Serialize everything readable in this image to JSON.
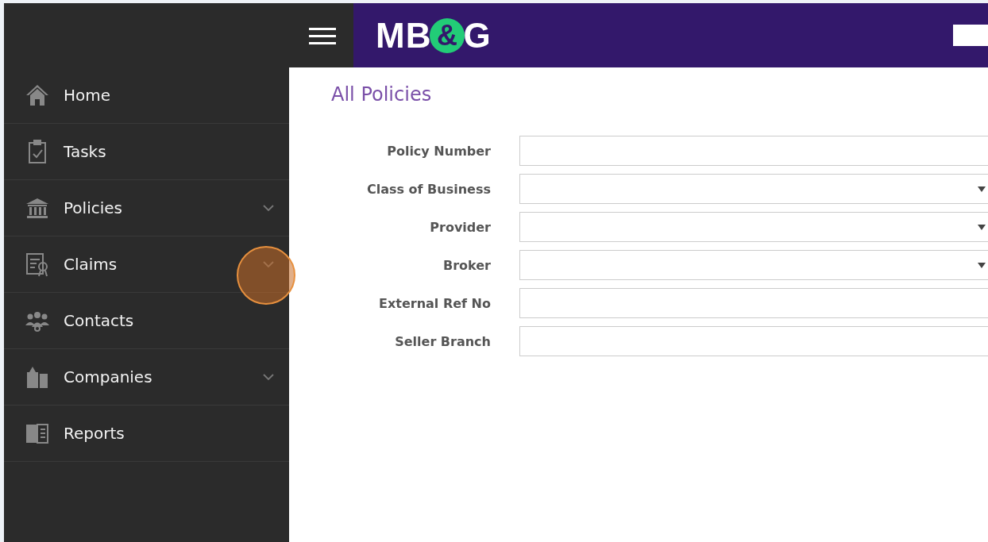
{
  "header": {
    "logo": {
      "text_before": "MB",
      "mark": "&",
      "text_after": "G"
    }
  },
  "sidebar": {
    "items": [
      {
        "label": "Home",
        "expandable": false,
        "highlighted": false
      },
      {
        "label": "Tasks",
        "expandable": false,
        "highlighted": false
      },
      {
        "label": "Policies",
        "expandable": true,
        "highlighted": false
      },
      {
        "label": "Claims",
        "expandable": true,
        "highlighted": true
      },
      {
        "label": "Contacts",
        "expandable": false,
        "highlighted": false
      },
      {
        "label": "Companies",
        "expandable": true,
        "highlighted": false
      },
      {
        "label": "Reports",
        "expandable": false,
        "highlighted": false
      }
    ]
  },
  "page_title": "All Policies",
  "form": {
    "fields": [
      {
        "label": "Policy Number",
        "kind": "text"
      },
      {
        "label": "Class of Business",
        "kind": "select"
      },
      {
        "label": "Provider",
        "kind": "select"
      },
      {
        "label": "Broker",
        "kind": "select"
      },
      {
        "label": "External Ref No",
        "kind": "text"
      },
      {
        "label": "Seller Branch",
        "kind": "text"
      }
    ]
  }
}
